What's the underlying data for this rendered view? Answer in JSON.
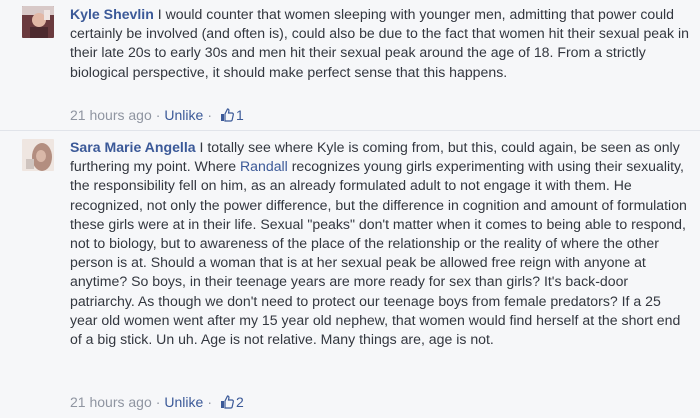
{
  "comments": [
    {
      "author": "Kyle Shevlin",
      "text": "I would counter that women sleeping with younger men, admitting that power could certainly be involved (and often is), could also be due to the fact that women hit their sexual peak in their late 20s to early 30s and men hit their sexual peak around the age of 18. From a strictly biological perspective, it should make perfect sense that this happens.",
      "time": "21 hours ago",
      "separator": "·",
      "unlike_label": "Unlike",
      "like_icon": "thumbs-up-icon",
      "like_count": "1"
    },
    {
      "author": "Sara Marie Angella",
      "text_before_mention": "I totally see where Kyle is coming from, but this, could again, be seen as only furthering my point. Where",
      "mention": "Randall",
      "text_after_mention": "recognizes young girls experimenting with using their sexuality, the responsibility fell on him, as an already formulated adult to not engage it with them. He recognized, not only the power difference, but the difference in cognition and amount of formulation these girls were at in their life. Sexual \"peaks\" don't matter when it comes to being able to respond, not to biology, but to awareness of the place of the relationship or the reality of where the other person is at. Should a woman that is at her sexual peak be allowed free reign with anyone at anytime? So boys, in their teenage years are more ready for sex than girls? It's back-door patriarchy. As though we don't need to protect our teenage boys from female predators? If a 25 year old women went after my 15 year old nephew, that women would find herself at the short end of a big stick. Un uh. Age is not relative. Many things are, age is not.",
      "time": "21 hours ago",
      "separator": "·",
      "unlike_label": "Unlike",
      "like_icon": "thumbs-up-icon",
      "like_count": "2"
    }
  ],
  "colors": {
    "author": "#3b5998",
    "text": "#33373f",
    "meta": "#8f95a1",
    "background": "#f6f7f9"
  }
}
